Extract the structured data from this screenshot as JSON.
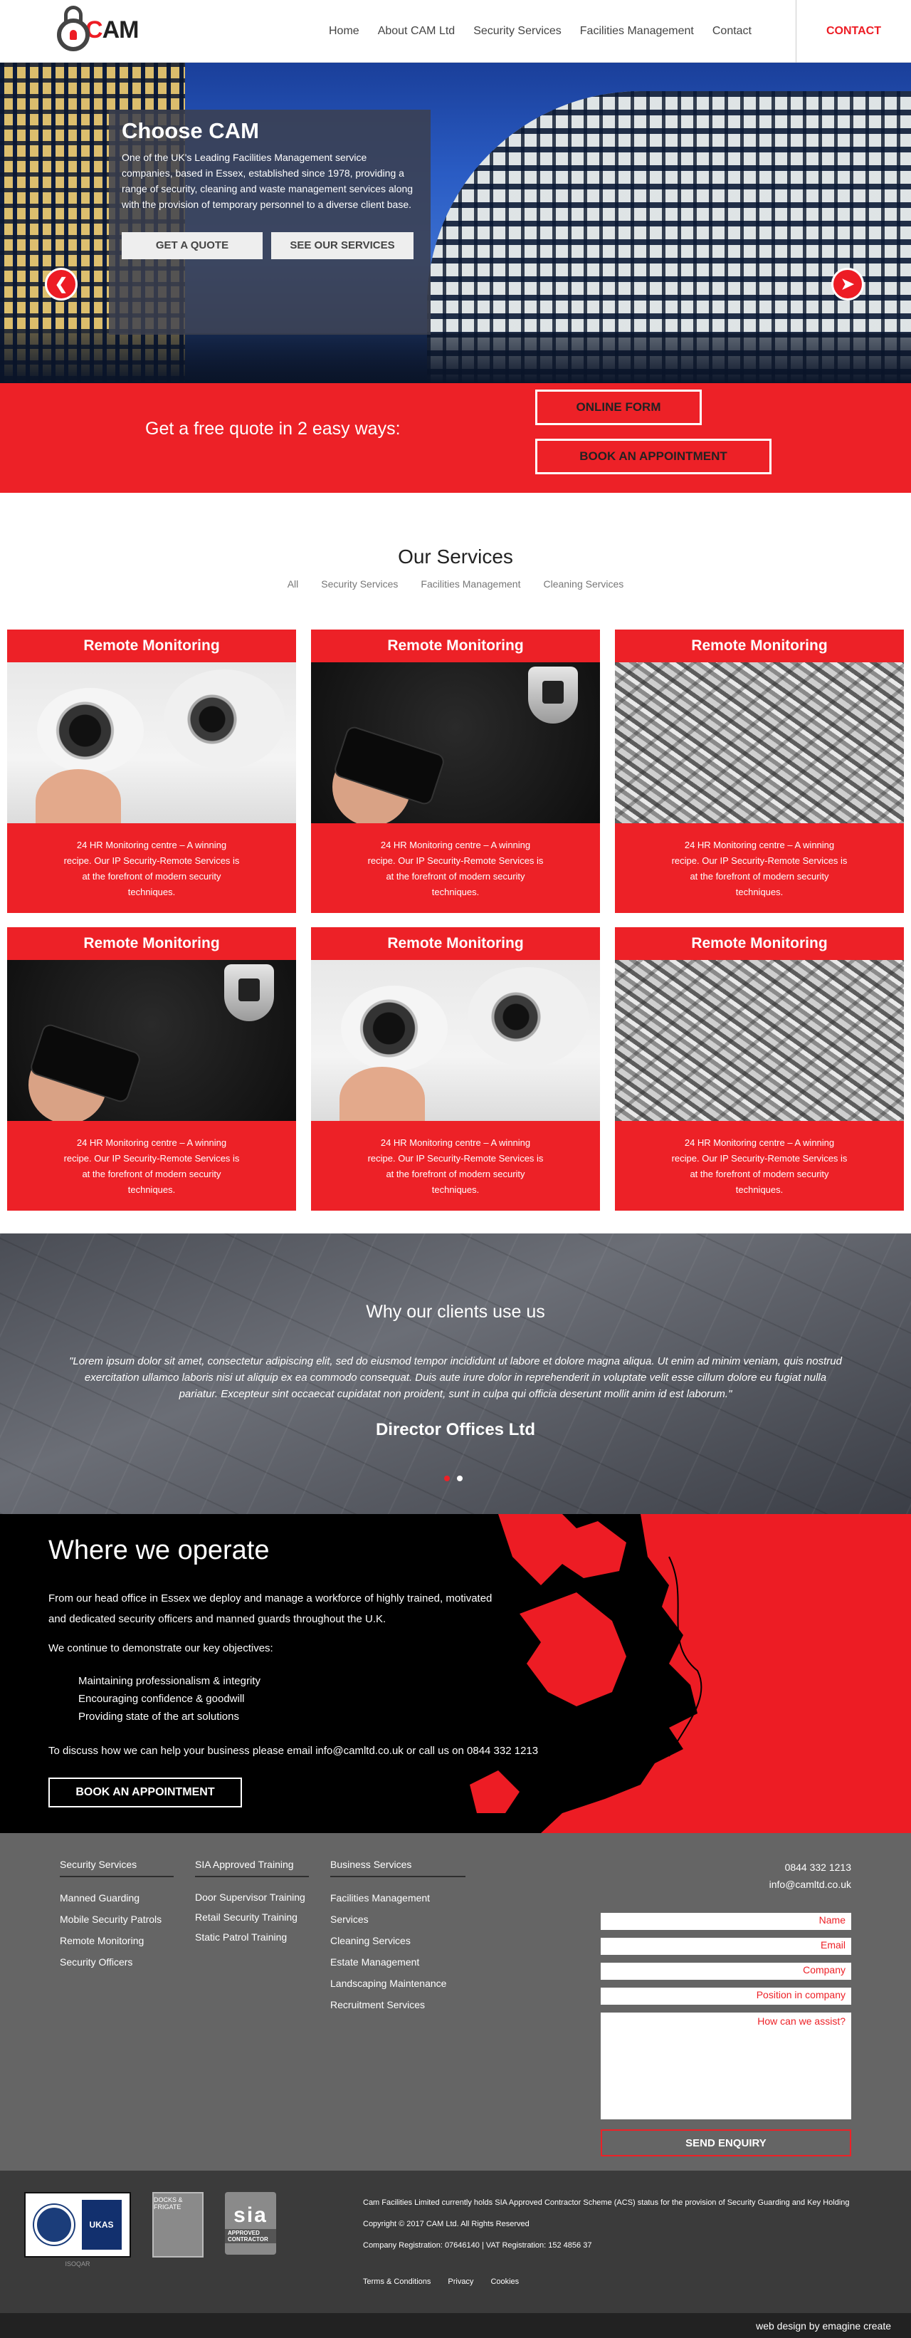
{
  "header": {
    "logo_text_c": "C",
    "logo_text_rest": "AM",
    "nav": [
      "Home",
      "About CAM Ltd",
      "Security Services",
      "Facilities Management",
      "Contact"
    ],
    "contact": "CONTACT"
  },
  "hero": {
    "title": "Choose CAM",
    "text": "One of the UK's Leading Facilities Management service companies, based in Essex, established since 1978, providing a range of security, cleaning and waste management services along with the provision of temporary personnel to a diverse client base.",
    "btn_quote": "GET A QUOTE",
    "btn_services": "SEE OUR SERVICES"
  },
  "quote": {
    "label": "Get a free quote in 2 easy ways:",
    "online_form": "ONLINE FORM",
    "book": "BOOK AN APPOINTMENT"
  },
  "services": {
    "title": "Our Services",
    "filters": [
      "All",
      "Security Services",
      "Facilities Management",
      "Cleaning Services"
    ],
    "cards": [
      {
        "title": "Remote Monitoring",
        "image": "cctv-cameras",
        "text": "24 HR Monitoring centre – A winning recipe. Our IP Security-Remote Services is at the forefront of modern security techniques."
      },
      {
        "title": "Remote Monitoring",
        "image": "security-guard",
        "text": "24 HR Monitoring centre – A winning recipe. Our IP Security-Remote Services is at the forefront of modern security techniques."
      },
      {
        "title": "Remote Monitoring",
        "image": "keys",
        "text": "24 HR Monitoring centre – A winning recipe. Our IP Security-Remote Services is at the forefront of modern security techniques."
      },
      {
        "title": "Remote Monitoring",
        "image": "security-guard",
        "text": "24 HR Monitoring centre – A winning recipe. Our IP Security-Remote Services is at the forefront of modern security techniques."
      },
      {
        "title": "Remote Monitoring",
        "image": "cctv-cameras",
        "text": "24 HR Monitoring centre – A winning recipe. Our IP Security-Remote Services is at the forefront of modern security techniques."
      },
      {
        "title": "Remote Monitoring",
        "image": "keys",
        "text": "24 HR Monitoring centre – A winning recipe. Our IP Security-Remote Services is at the forefront of modern security techniques."
      }
    ]
  },
  "testimonial": {
    "title": "Why our clients use us",
    "quote": "\"Lorem ipsum dolor sit amet, consectetur adipiscing elit, sed do eiusmod tempor incididunt ut labore et dolore magna aliqua. Ut enim ad minim veniam, quis nostrud exercitation ullamco laboris nisi ut aliquip ex ea commodo consequat. Duis aute irure dolor in reprehenderit in voluptate velit esse cillum dolore eu fugiat nulla pariatur. Excepteur sint occaecat cupidatat non proident, sunt in culpa qui officia deserunt mollit anim id est laborum.\"",
    "author": "Director Offices Ltd"
  },
  "operate": {
    "title": "Where we operate",
    "p1": "From our head office in Essex we deploy and manage a workforce of highly trained, motivated and dedicated security officers and manned guards throughout the U.K.",
    "p2": "We continue to demonstrate our key objectives:",
    "objectives": [
      "Maintaining professionalism & integrity",
      "Encouraging confidence & goodwill",
      "Providing state of the art solutions"
    ],
    "p3": "To discuss how we can help your business please email info@camltd.co.uk or call us on 0844 332 1213",
    "button": "BOOK AN APPOINTMENT"
  },
  "footer": {
    "col1": {
      "title": "Security Services",
      "links": [
        "Manned Guarding",
        "Mobile Security Patrols",
        "Remote Monitoring",
        "Security Officers"
      ]
    },
    "col2": {
      "title": "SIA Approved Training",
      "links": [
        "Door Supervisor Training",
        "Retail Security Training",
        "Static Patrol Training"
      ]
    },
    "col3": {
      "title": "Business Services",
      "links": [
        "Facilities Management Services",
        "Cleaning Services",
        "Estate Management",
        "Landscaping Maintenance",
        "Recruitment Services"
      ]
    },
    "phone": "0844 332 1213",
    "email": "info@camltd.co.uk",
    "form": {
      "name": "Name",
      "email": "Email",
      "company": "Company",
      "position": "Position in company",
      "message": "How can we assist?",
      "send": "SEND ENQUIRY"
    }
  },
  "bottom": {
    "logo1_caption": "ISOQAR",
    "logo1_ukas": "UKAS",
    "logo2_caption": "DOCKS & FRIGATE",
    "logo3_big": "sia",
    "logo3_small": "APPROVED CONTRACTOR",
    "legal1": "Cam Facilities Limited currently holds SIA Approved Contractor Scheme (ACS) status for the provision of Security Guarding and Key Holding",
    "legal2": "Copyright © 2017 CAM Ltd. All Rights Reserved",
    "legal3": "Company Registration: 07646140 | VAT Registration: 152 4856 37",
    "links": [
      "Terms & Conditions",
      "Privacy",
      "Cookies"
    ],
    "credit": "web design by emagine create"
  }
}
